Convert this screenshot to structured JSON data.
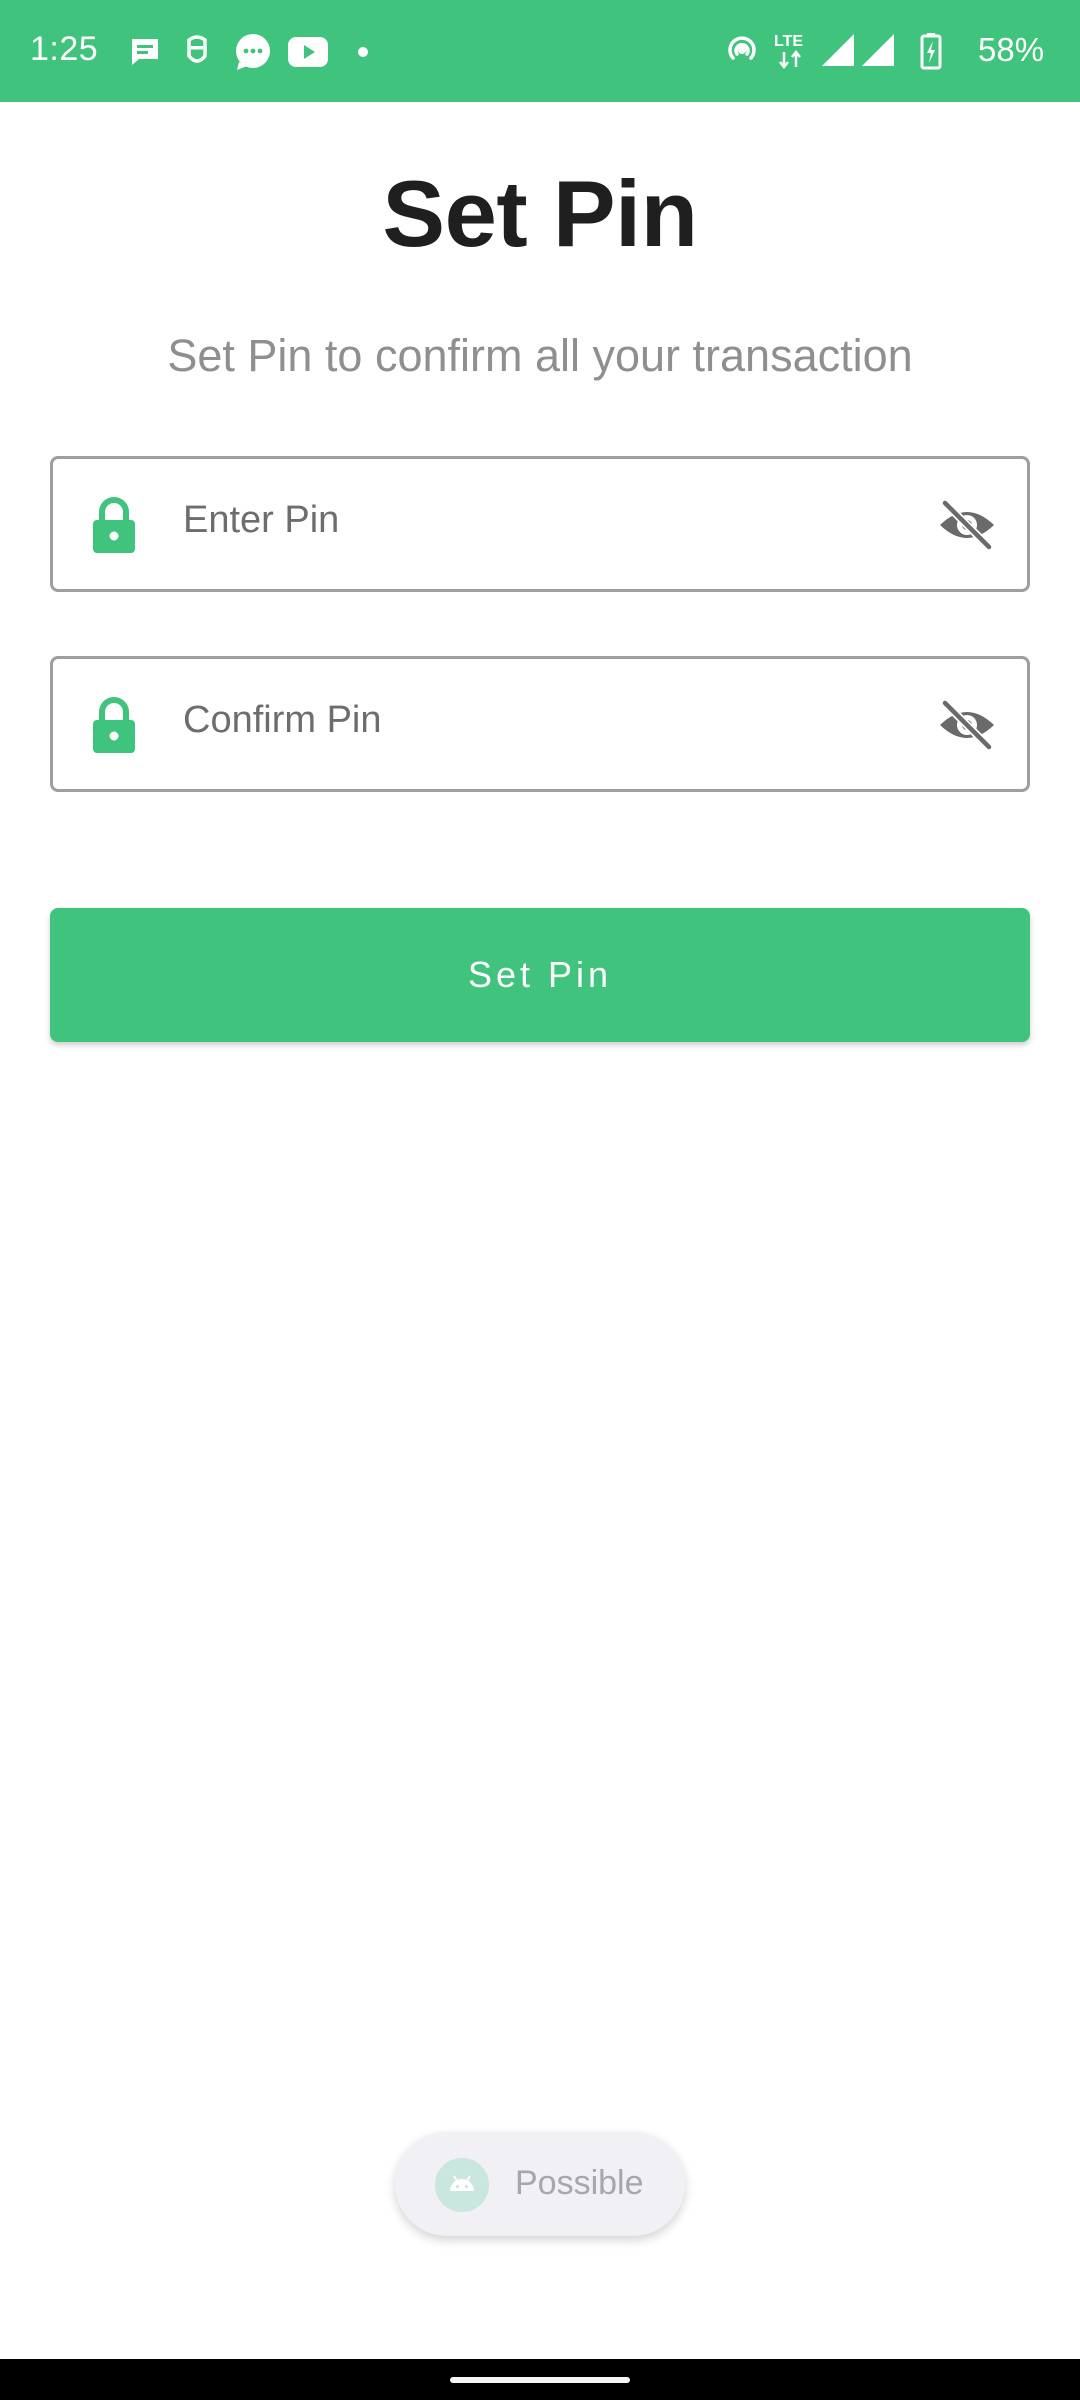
{
  "status_bar": {
    "time": "1:25",
    "battery": "58%",
    "background_color": "#40c47d",
    "notification_icons": [
      "messages-icon",
      "tweaker-icon",
      "chat-bubble-icon",
      "youtube-icon",
      "dot-icon"
    ],
    "system_icons": [
      "hotspot-icon",
      "lte-icon",
      "signal-icon",
      "signal-icon",
      "battery-charging-icon"
    ],
    "lte_label": "LTE"
  },
  "page": {
    "title": "Set Pin",
    "subtitle": "Set Pin to confirm all your transaction"
  },
  "form": {
    "enter_pin": {
      "placeholder": "Enter Pin",
      "value": "",
      "leading_icon": "lock-icon",
      "trailing_icon": "visibility-off-icon"
    },
    "confirm_pin": {
      "placeholder": "Confirm Pin",
      "value": "",
      "leading_icon": "lock-icon",
      "trailing_icon": "visibility-off-icon"
    },
    "submit_label": "Set Pin",
    "accent_color": "#40c47d"
  },
  "toast": {
    "text": "Possible",
    "icon": "android-icon"
  }
}
